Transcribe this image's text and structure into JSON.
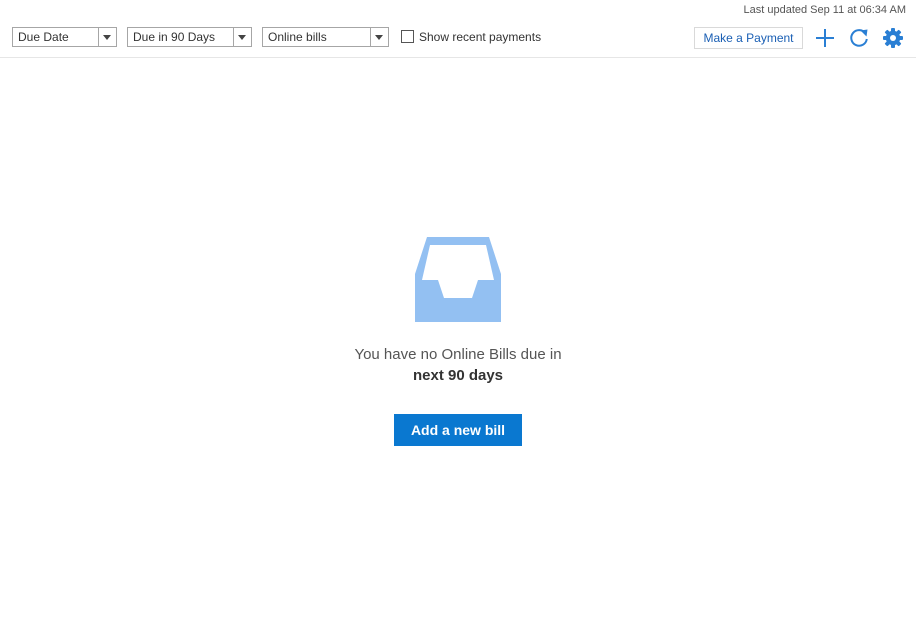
{
  "header": {
    "last_updated": "Last updated Sep 11 at 06:34 AM"
  },
  "toolbar": {
    "sort_select": {
      "value": "Due Date"
    },
    "range_select": {
      "value": "Due in 90 Days"
    },
    "type_select": {
      "value": "Online bills"
    },
    "show_recent_payments": {
      "label": "Show recent payments",
      "checked": false
    },
    "make_payment_label": "Make a Payment",
    "icons": [
      "add-icon",
      "refresh-icon",
      "gear-icon"
    ]
  },
  "empty_state": {
    "icon": "inbox-tray-icon",
    "message_line1": "You have no Online Bills due in",
    "message_line2": "next 90 days",
    "add_bill_label": "Add a new bill"
  },
  "colors": {
    "accent": "#0a78d0",
    "link": "#1a5fb4",
    "icon_blue": "#2a7fd4",
    "empty_icon": "#93c0f2"
  }
}
